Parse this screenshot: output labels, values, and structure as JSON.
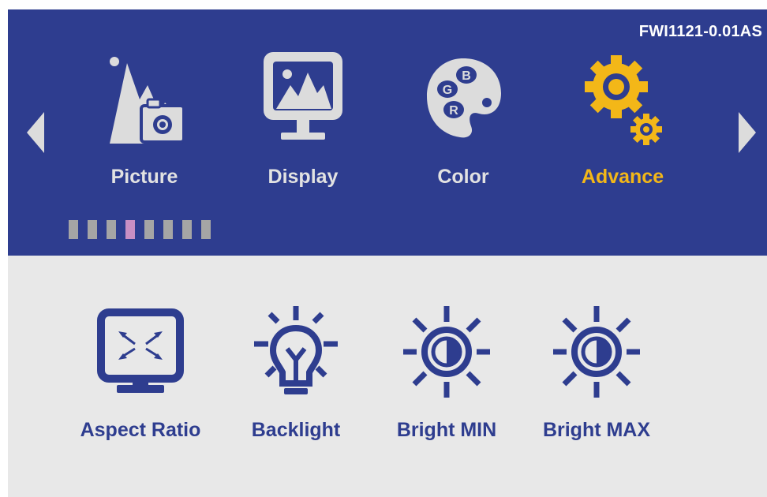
{
  "firmware_version": "FWI1121-0.01AS",
  "tabs": [
    {
      "label": "Picture",
      "icon": "picture-mountain-camera-icon",
      "active": false
    },
    {
      "label": "Display",
      "icon": "monitor-image-icon",
      "active": false
    },
    {
      "label": "Color",
      "icon": "palette-rgb-icon",
      "active": false
    },
    {
      "label": "Advance",
      "icon": "gears-icon",
      "active": true
    }
  ],
  "palette_letters": {
    "b": "B",
    "g": "G",
    "r": "R"
  },
  "page_indicator": {
    "count": 8,
    "current": 4
  },
  "items": [
    {
      "label": "Aspect Ratio",
      "icon": "aspect-ratio-monitor-icon"
    },
    {
      "label": "Backlight",
      "icon": "backlight-bulb-icon"
    },
    {
      "label": "Bright MIN",
      "icon": "brightness-sun-icon"
    },
    {
      "label": "Bright MAX",
      "icon": "brightness-sun-icon"
    }
  ],
  "colors": {
    "header_bg": "#2e3d8f",
    "body_bg": "#e8e8e8",
    "active_accent": "#f3b718",
    "icon_grey": "#dcdcdc",
    "page_indicator_on": "#c98fc4",
    "page_indicator_off": "#a5a5a5"
  }
}
